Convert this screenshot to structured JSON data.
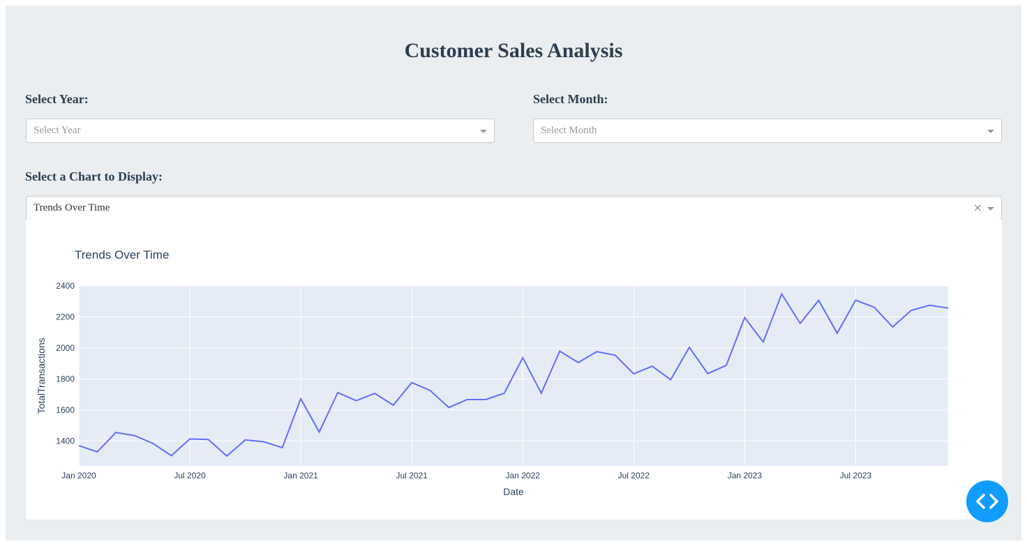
{
  "page": {
    "title": "Customer Sales Analysis"
  },
  "filters": {
    "year": {
      "label": "Select Year:",
      "placeholder": "Select Year"
    },
    "month": {
      "label": "Select Month:",
      "placeholder": "Select Month"
    },
    "chart_select": {
      "label": "Select a Chart to Display:",
      "value": "Trends Over Time",
      "clear_symbol": "×"
    }
  },
  "colors": {
    "line": "#636efa",
    "plot_bg": "#e5ecf6",
    "title": "#2c3e50",
    "fab": "#119dff"
  },
  "chart_data": {
    "type": "line",
    "title": "Trends Over Time",
    "xlabel": "Date",
    "ylabel": "TotalTransactions",
    "xlim": [
      "2020-01",
      "2023-12"
    ],
    "ylim": [
      1240,
      2400
    ],
    "yticks": [
      1400,
      1600,
      1800,
      2000,
      2200,
      2400
    ],
    "xticks": [
      "Jan 2020",
      "Jul 2020",
      "Jan 2021",
      "Jul 2021",
      "Jan 2022",
      "Jul 2022",
      "Jan 2023",
      "Jul 2023"
    ],
    "grid": true,
    "series": [
      {
        "x": [
          "2020-01",
          "2020-02",
          "2020-03",
          "2020-04",
          "2020-05",
          "2020-06",
          "2020-07",
          "2020-08",
          "2020-09",
          "2020-10",
          "2020-11",
          "2020-12",
          "2021-01",
          "2021-02",
          "2021-03",
          "2021-04",
          "2021-05",
          "2021-06",
          "2021-07",
          "2021-08",
          "2021-09",
          "2021-10",
          "2021-11",
          "2021-12",
          "2022-01",
          "2022-02",
          "2022-03",
          "2022-04",
          "2022-05",
          "2022-06",
          "2022-07",
          "2022-08",
          "2022-09",
          "2022-10",
          "2022-11",
          "2022-12",
          "2023-01",
          "2023-02",
          "2023-03",
          "2023-04",
          "2023-05",
          "2023-06",
          "2023-07",
          "2023-08",
          "2023-09",
          "2023-10",
          "2023-11",
          "2023-12"
        ],
        "values": [
          1370,
          1330,
          1455,
          1435,
          1385,
          1305,
          1413,
          1410,
          1303,
          1407,
          1395,
          1357,
          1672,
          1458,
          1712,
          1660,
          1707,
          1631,
          1777,
          1725,
          1616,
          1667,
          1667,
          1708,
          1937,
          1708,
          1979,
          1906,
          1976,
          1953,
          1833,
          1882,
          1795,
          2004,
          1835,
          1887,
          2196,
          2038,
          2348,
          2158,
          2307,
          2095,
          2308,
          2262,
          2135,
          2242,
          2275,
          2257
        ]
      }
    ]
  }
}
